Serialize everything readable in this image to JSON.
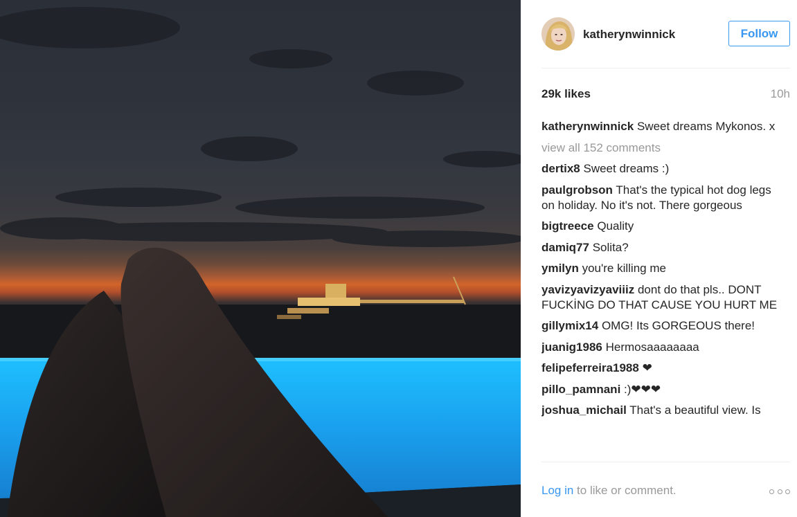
{
  "post": {
    "username": "katherynwinnick",
    "follow_label": "Follow",
    "likes": "29k likes",
    "time": "10h",
    "caption": {
      "user": "katherynwinnick",
      "text": "Sweet dreams Mykonos. x"
    },
    "view_all": "view all 152 comments",
    "comments": [
      {
        "user": "dertix8",
        "text": "Sweet dreams :)"
      },
      {
        "user": "paulgrobson",
        "text": "That's the typical hot dog legs on holiday. No it's not. There gorgeous"
      },
      {
        "user": "bigtreece",
        "text": "Quality"
      },
      {
        "user": "damiq77",
        "text": "Solita?"
      },
      {
        "user": "ymilyn",
        "text": "you're killing me"
      },
      {
        "user": "yavizyavizyaviiiz",
        "text": "dont do that pls.. DONT FUCKİNG DO THAT CAUSE YOU HURT ME"
      },
      {
        "user": "gillymix14",
        "text": "OMG! Its GORGEOUS there!"
      },
      {
        "user": "juanig1986",
        "text": "Hermosaaaaaaaa"
      },
      {
        "user": "felipeferreira1988",
        "text": "❤"
      },
      {
        "user": "pillo_pamnani",
        "text": ":)❤❤❤"
      },
      {
        "user": "joshua_michail",
        "text": "That's a beautiful view. Is"
      }
    ],
    "footer": {
      "login_label": "Log in",
      "rest": " to like or comment."
    }
  },
  "icons": {
    "more": "more-options-icon"
  },
  "colors": {
    "accent": "#3897f0",
    "muted": "#999999",
    "text": "#262626",
    "pool": "#1aa8f0"
  }
}
